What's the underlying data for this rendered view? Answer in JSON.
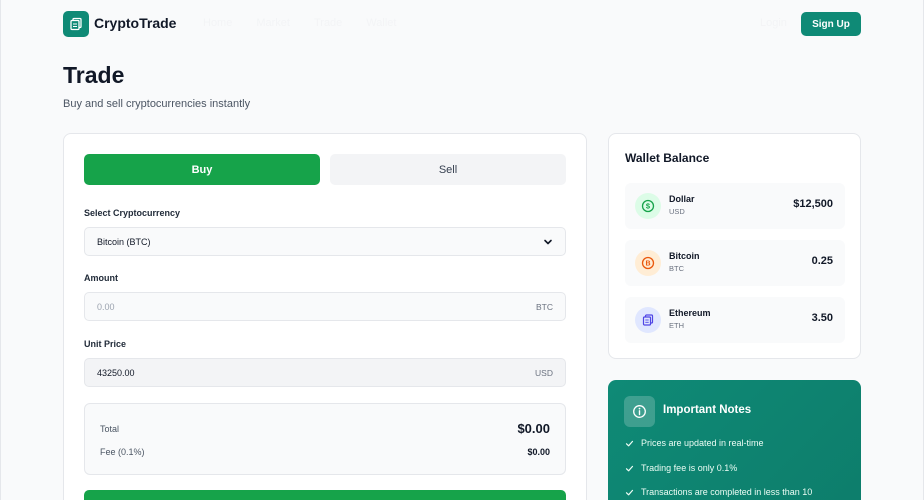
{
  "header": {
    "logo_text": "CryptoTrade",
    "nav": [
      "Home",
      "Market",
      "Trade",
      "Wallet"
    ],
    "login_label": "Login",
    "signup_label": "Sign Up"
  },
  "page": {
    "title": "Trade",
    "subtitle": "Buy and sell cryptocurrencies instantly"
  },
  "trade": {
    "tabs": {
      "buy": "Buy",
      "sell": "Sell"
    },
    "crypto_label": "Select Cryptocurrency",
    "crypto_value": "Bitcoin (BTC)",
    "amount_label": "Amount",
    "amount_placeholder": "0.00",
    "amount_unit": "BTC",
    "price_label": "Unit Price",
    "price_value": "43250.00",
    "price_unit": "USD",
    "total_label": "Total",
    "total_value": "$0.00",
    "fee_label": "Fee (0.1%)",
    "fee_value": "$0.00"
  },
  "wallet": {
    "title": "Wallet Balance",
    "items": [
      {
        "name": "Dollar",
        "code": "USD",
        "amount": "$12,500",
        "icon": "dollar-icon",
        "color": "#16a34a",
        "bg": "#dcfce7"
      },
      {
        "name": "Bitcoin",
        "code": "BTC",
        "amount": "0.25",
        "icon": "bitcoin-icon",
        "color": "#ea580c",
        "bg": "#ffedd5"
      },
      {
        "name": "Ethereum",
        "code": "ETH",
        "amount": "3.50",
        "icon": "ethereum-icon",
        "color": "#4f46e5",
        "bg": "#e0e7ff"
      }
    ]
  },
  "notes": {
    "title": "Important Notes",
    "items": [
      "Prices are updated in real-time",
      "Trading fee is only 0.1%",
      "Transactions are completed in less than 10"
    ]
  },
  "colors": {
    "brand": "#0f8a76",
    "buy": "#16a34a"
  }
}
